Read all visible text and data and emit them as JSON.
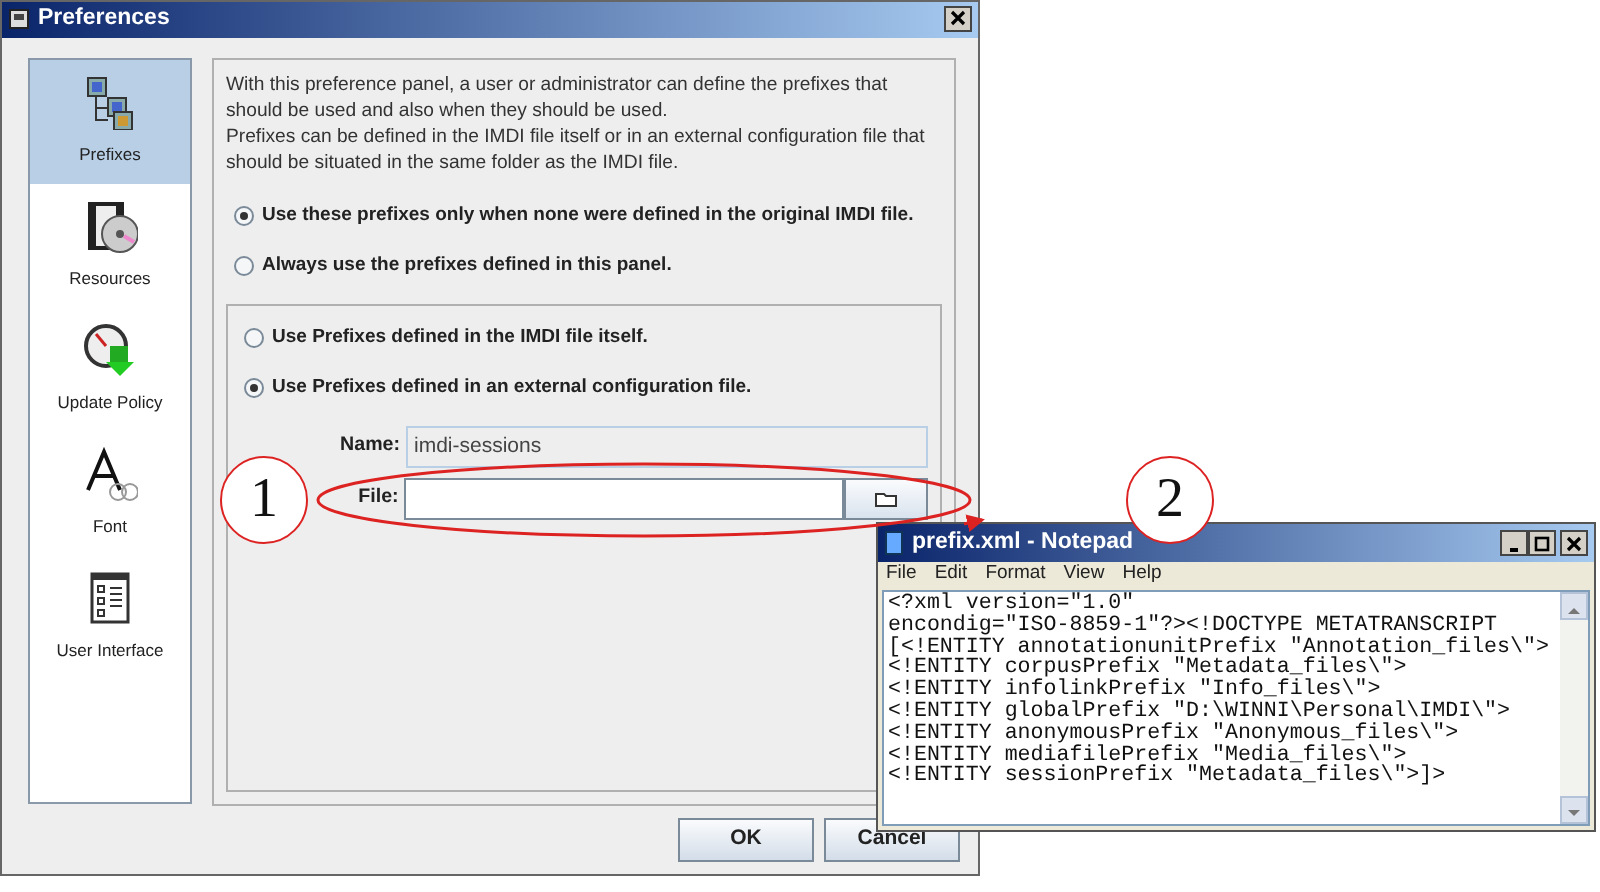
{
  "dialog": {
    "title": "Preferences",
    "sidebar": [
      {
        "label": "Prefixes",
        "selected": true
      },
      {
        "label": "Resources",
        "selected": false
      },
      {
        "label": "Update Policy",
        "selected": false
      },
      {
        "label": "Font",
        "selected": false
      },
      {
        "label": "User Interface",
        "selected": false
      }
    ],
    "description": [
      "With this preference panel, a user or administrator can define the prefixes that should be used and also when they should be used.",
      "Prefixes can be defined in the IMDI file itself or in an external configuration file that should be situated in the same folder as the IMDI file."
    ],
    "scope_options": [
      {
        "label": "Use these prefixes only when none were defined in the original IMDI file.",
        "selected": true
      },
      {
        "label": "Always use the prefixes defined in this panel.",
        "selected": false
      }
    ],
    "source_options": [
      {
        "label": "Use Prefixes defined in the IMDI file itself.",
        "selected": false
      },
      {
        "label": "Use Prefixes defined in an external configuration file.",
        "selected": true
      }
    ],
    "name_field": {
      "label": "Name:",
      "value": "imdi-sessions",
      "disabled": true
    },
    "file_field": {
      "label": "File:"
    },
    "buttons": [
      "OK",
      "Cancel"
    ]
  },
  "callouts": [
    "1",
    "2"
  ],
  "notepad": {
    "title": "prefix.xml - Notepad",
    "menu": [
      "File",
      "Edit",
      "Format",
      "View",
      "Help"
    ],
    "lines": [
      "<?xml version=\"1.0\"",
      "encondig=\"ISO-8859-1\"?><!DOCTYPE METATRANSCRIPT",
      "[<!ENTITY annotationunitPrefix \"Annotation_files\\\">",
      "<!ENTITY corpusPrefix \"Metadata_files\\\">",
      "<!ENTITY infolinkPrefix \"Info_files\\\">",
      "<!ENTITY globalPrefix \"D:\\WINNI\\Personal\\IMDI\\\">",
      "<!ENTITY anonymousPrefix \"Anonymous_files\\\">",
      "<!ENTITY mediafilePrefix \"Media_files\\\">",
      "<!ENTITY sessionPrefix \"Metadata_files\\\">]>"
    ]
  }
}
